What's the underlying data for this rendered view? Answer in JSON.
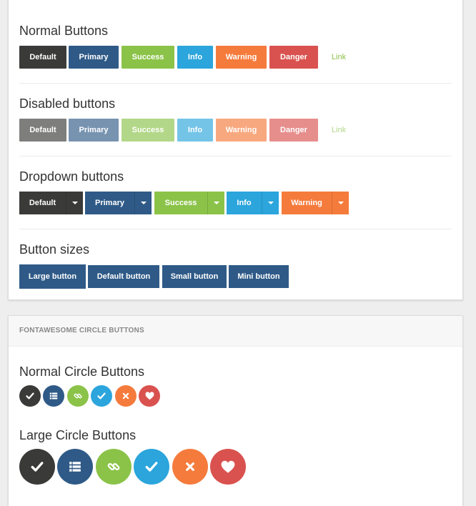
{
  "normal_buttons": {
    "title": "Normal Buttons",
    "buttons": [
      "Default",
      "Primary",
      "Success",
      "Info",
      "Warning",
      "Danger",
      "Link"
    ]
  },
  "disabled_buttons": {
    "title": "Disabled buttons",
    "buttons": [
      "Default",
      "Primary",
      "Success",
      "Info",
      "Warning",
      "Danger",
      "Link"
    ]
  },
  "dropdown_buttons": {
    "title": "Dropdown buttons",
    "buttons": [
      "Default",
      "Primary",
      "Success",
      "Info",
      "Warning"
    ]
  },
  "button_sizes": {
    "title": "Button sizes",
    "buttons": [
      "Large button",
      "Default button",
      "Small button",
      "Mini button"
    ]
  },
  "circle_panel": {
    "heading": "FONTAWESOME CIRCLE BUTTONS",
    "normal_title": "Normal Circle Buttons",
    "large_title": "Large Circle Buttons",
    "icons": [
      "check-icon",
      "list-icon",
      "link-icon",
      "check-icon",
      "times-icon",
      "heart-icon"
    ]
  },
  "colors": {
    "default": "#3a3a38",
    "primary": "#2f5a87",
    "success": "#8bc349",
    "info": "#2ba5dc",
    "warning": "#f57b3c",
    "danger": "#d9524f"
  }
}
